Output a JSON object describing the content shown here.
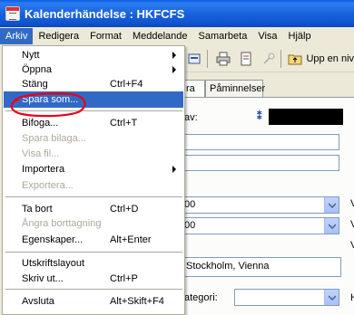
{
  "window": {
    "title": "Kalenderhändelse : HKFCFS"
  },
  "menubar": [
    "Arkiv",
    "Redigera",
    "Format",
    "Meddelande",
    "Samarbeta",
    "Visa",
    "Hjälp"
  ],
  "toolbar": {
    "button_label": "Upp en niv"
  },
  "tabs": [
    "ra",
    "Påminnelser"
  ],
  "form": {
    "from_label": "av:",
    "time_combo_1": "00",
    "time_combo_2": "00",
    "timezone_value": "Stockholm, Vienna",
    "category_label": "ategori:",
    "v_label_1": "V",
    "v_label_2": "V",
    "v_label_3": "V",
    "h_label": "H"
  },
  "menu": {
    "items": [
      {
        "label": "Nytt",
        "accel": "",
        "submenu": true,
        "disabled": false
      },
      {
        "label": "Öppna",
        "accel": "",
        "submenu": true,
        "disabled": false
      },
      {
        "label": "Stäng",
        "accel": "Ctrl+F4",
        "submenu": false,
        "disabled": false
      },
      {
        "label": "Spara som...",
        "accel": "",
        "submenu": false,
        "disabled": false,
        "selected": true
      },
      {
        "label": "Bifoga...",
        "accel": "Ctrl+T",
        "submenu": false,
        "disabled": false
      },
      {
        "label": "Spara bilaga...",
        "accel": "",
        "submenu": false,
        "disabled": true
      },
      {
        "label": "Visa fil...",
        "accel": "",
        "submenu": false,
        "disabled": true
      },
      {
        "label": "Importera",
        "accel": "",
        "submenu": true,
        "disabled": false
      },
      {
        "label": "Exportera...",
        "accel": "",
        "submenu": false,
        "disabled": true
      },
      {
        "label": "Ta bort",
        "accel": "Ctrl+D",
        "submenu": false,
        "disabled": false
      },
      {
        "label": "Ångra borttagning",
        "accel": "",
        "submenu": false,
        "disabled": true
      },
      {
        "label": "Egenskaper...",
        "accel": "Alt+Enter",
        "submenu": false,
        "disabled": false
      },
      {
        "label": "Utskriftslayout",
        "accel": "",
        "submenu": false,
        "disabled": false
      },
      {
        "label": "Skriv ut...",
        "accel": "Ctrl+P",
        "submenu": false,
        "disabled": false
      },
      {
        "label": "Avsluta",
        "accel": "Alt+Skift+F4",
        "submenu": false,
        "disabled": false
      }
    ]
  },
  "colors": {
    "selection": "#316ac5",
    "titlebar": "#0a5be0",
    "annotation": "#e8001c"
  },
  "icons": [
    "calendar-app-icon",
    "print-icon",
    "form-icon",
    "key-icon",
    "folder-up-icon"
  ]
}
